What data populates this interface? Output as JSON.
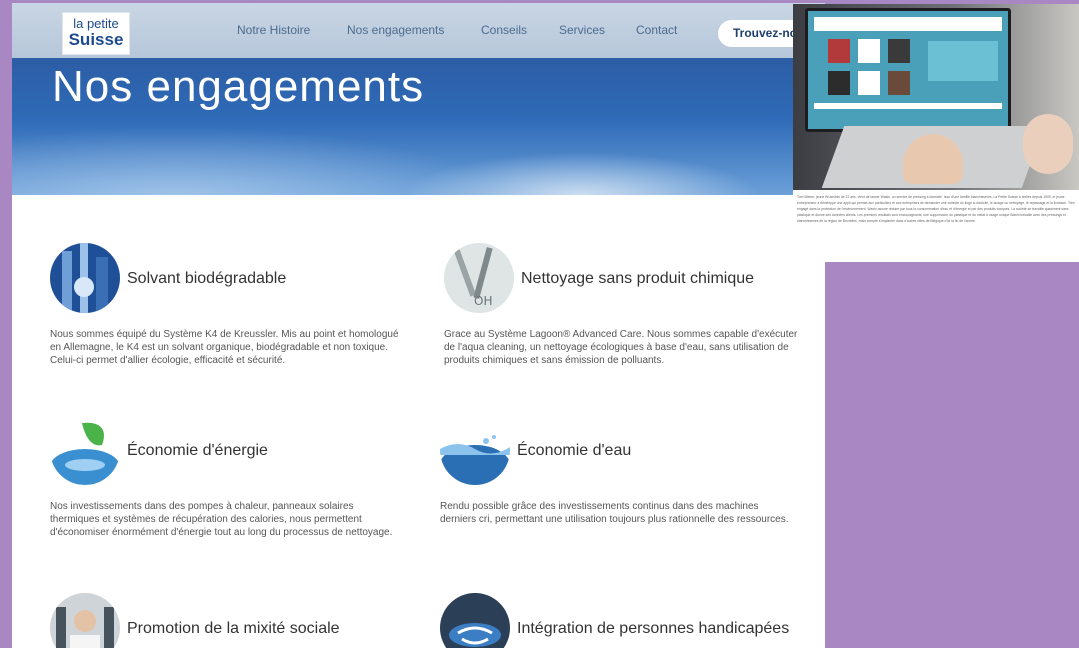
{
  "brand": {
    "line1": "la petite",
    "line2": "Suisse"
  },
  "nav": {
    "items": [
      "Notre Histoire",
      "Nos engagements",
      "Conseils",
      "Services",
      "Contact"
    ],
    "cta": "Trouvez-no"
  },
  "hero": {
    "title": "Nos engagements"
  },
  "engagements": [
    {
      "title": "Solvant biodégradable",
      "icon": "solvent-icon",
      "text": "Nous sommes équipé du Système K4 de Kreussler. Mis au point et homologué en Allemagne, le K4 est un solvant organique, biodégradable et non toxique. Celui-ci permet d'allier écologie, efficacité et sécurité."
    },
    {
      "title": "Nettoyage sans produit chimique",
      "icon": "chemistry-icon",
      "text": "Grace au Système Lagoon® Advanced Care. Nous sommes capable d'exécuter de l'aqua cleaning, un nettoyage écologiques à base d'eau, sans utilisation de produits chimiques et sans émission de polluants."
    },
    {
      "title": "Économie d'énergie",
      "icon": "leaf-water-icon",
      "text": "Nos investissements dans des pompes à chaleur, panneaux solaires thermiques et systèmes de récupération des calories, nous permettent d'économiser énormément d'énergie tout au long du processus de nettoyage."
    },
    {
      "title": "Économie d'eau",
      "icon": "water-splash-icon",
      "text": "Rendu possible grâce des investissements continus dans des machines derniers cri, permettant une utilisation toujours plus rationnelle des ressources."
    },
    {
      "title": "Promotion de la mixité sociale",
      "icon": "person-icon",
      "text": ""
    },
    {
      "title": "Intégration de personnes handicapées",
      "icon": "accessibility-icon",
      "text": ""
    }
  ],
  "overlay": {
    "text": "Tom Weber, jeune Bruxellois de 22 ans, vient de lancer Washi, un service de pressing à domicile. Issu d'une famille blanchisseurs, La Petite Suisse à Ixelles depuis 1905, le jeune entrepreneur a développé une appli qui permet aux particuliers et aux entreprises de demander une collecte du linge à domicile, le lavage ou nettoyage, le repassage et la livraison. Très engagé dans la protection de l'environnement, Washi assure réduire par tous la consommation d'eau et d'énergie et par des produits toxiques. La société se travaille quasiment sans plastique et donne ses données clients. Les premiers résultats sont encourageants, une suppression du plastique et du métal à usage unique Washi travaille avec des pressings et blanchisseries de la région de Bruxelles, mais compte s'implanter dans d'autres villes de Belgique d'ici la fin de l'année."
  },
  "colors": {
    "background": "#a987c3",
    "navbar": "#b6c7da",
    "hero": "#2f6bb8",
    "text": "#333333"
  }
}
